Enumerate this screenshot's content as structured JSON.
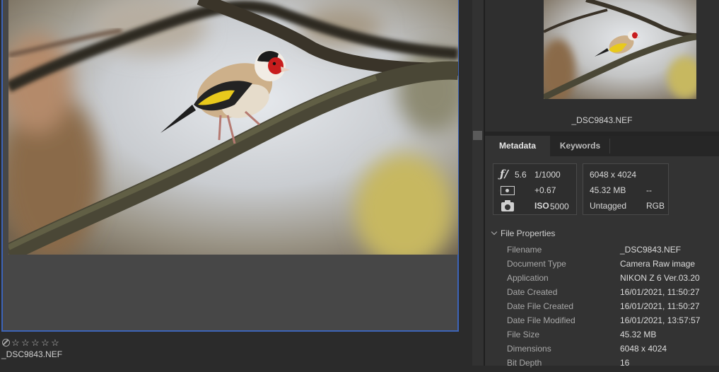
{
  "thumbnail": {
    "filename": "_DSC9843.NEF",
    "rating_stars": [
      "☆",
      "☆",
      "☆",
      "☆",
      "☆"
    ]
  },
  "preview": {
    "filename": "_DSC9843.NEF"
  },
  "tabs": {
    "metadata": "Metadata",
    "keywords": "Keywords"
  },
  "exposure": {
    "aperture_icon": "ƒ/",
    "aperture": "5.6",
    "shutter": "1/1000",
    "exposure_comp": "+0.67",
    "iso_label": "ISO",
    "iso": "5000"
  },
  "image_info": {
    "dimensions": "6048 x 4024",
    "size": "45.32 MB",
    "size_extra": "--",
    "color_profile": "Untagged",
    "color_mode": "RGB"
  },
  "file_properties": {
    "header": "File Properties",
    "rows": [
      {
        "label": "Filename",
        "value": "_DSC9843.NEF"
      },
      {
        "label": "Document Type",
        "value": "Camera Raw image"
      },
      {
        "label": "Application",
        "value": "NIKON Z 6 Ver.03.20"
      },
      {
        "label": "Date Created",
        "value": "16/01/2021, 11:50:27"
      },
      {
        "label": "Date File Created",
        "value": "16/01/2021, 11:50:27"
      },
      {
        "label": "Date File Modified",
        "value": "16/01/2021, 13:57:57"
      },
      {
        "label": "File Size",
        "value": "45.32 MB"
      },
      {
        "label": "Dimensions",
        "value": "6048 x 4024"
      },
      {
        "label": "Bit Depth",
        "value": "16"
      }
    ]
  },
  "colors": {
    "selection_border": "#3d64b8",
    "panel_bg": "#333333",
    "app_bg": "#2b2b2b"
  },
  "icons": [
    "reject-icon",
    "star-icon",
    "aperture-icon",
    "metering-icon",
    "camera-icon",
    "chevron-down-icon"
  ]
}
